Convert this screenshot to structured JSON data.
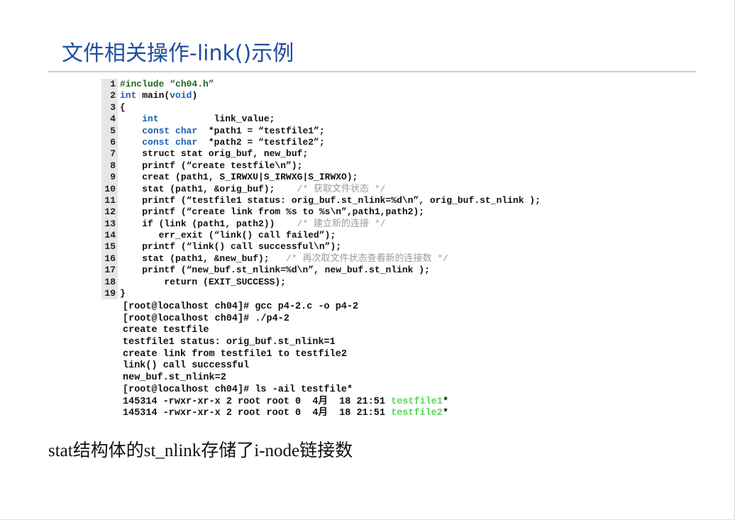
{
  "title": "文件相关操作-link()示例",
  "code_lines": [
    {
      "n": "1",
      "segs": [
        {
          "t": "#include ",
          "c": "str"
        },
        {
          "t": "“ch04.h”",
          "c": "str"
        }
      ]
    },
    {
      "n": "2",
      "segs": [
        {
          "t": "int",
          "c": "kw"
        },
        {
          "t": " main(",
          "c": ""
        },
        {
          "t": "void",
          "c": "kw"
        },
        {
          "t": ")",
          "c": ""
        }
      ]
    },
    {
      "n": "3",
      "segs": [
        {
          "t": "{",
          "c": ""
        }
      ]
    },
    {
      "n": "4",
      "segs": [
        {
          "t": "    ",
          "c": ""
        },
        {
          "t": "int",
          "c": "kw"
        },
        {
          "t": "          link_value;",
          "c": ""
        }
      ]
    },
    {
      "n": "5",
      "segs": [
        {
          "t": "    ",
          "c": ""
        },
        {
          "t": "const char",
          "c": "kw"
        },
        {
          "t": "  *path1 = “testfile1”;",
          "c": ""
        }
      ]
    },
    {
      "n": "6",
      "segs": [
        {
          "t": "    ",
          "c": ""
        },
        {
          "t": "const char",
          "c": "kw"
        },
        {
          "t": "  *path2 = “testfile2”;",
          "c": ""
        }
      ]
    },
    {
      "n": "7",
      "segs": [
        {
          "t": "    struct stat orig_buf, new_buf;",
          "c": ""
        }
      ]
    },
    {
      "n": "8",
      "segs": [
        {
          "t": "    printf (“create testfile\\n”);",
          "c": ""
        }
      ]
    },
    {
      "n": "9",
      "segs": [
        {
          "t": "    creat (path1, S_IRWXU|S_IRWXG|S_IRWXO);",
          "c": ""
        }
      ]
    },
    {
      "n": "10",
      "segs": [
        {
          "t": "    stat (path1, &orig_buf);    ",
          "c": ""
        },
        {
          "t": "/* 获取文件状态 */",
          "c": "cmt"
        }
      ]
    },
    {
      "n": "11",
      "segs": [
        {
          "t": "    printf (“testfile1 status: orig_buf.st_nlink=%d\\n”, orig_buf.st_nlink );",
          "c": ""
        }
      ]
    },
    {
      "n": "12",
      "segs": [
        {
          "t": "    printf (“create link from %s to %s\\n”,path1,path2);",
          "c": ""
        }
      ]
    },
    {
      "n": "13",
      "segs": [
        {
          "t": "    if (link (path1, path2))    ",
          "c": ""
        },
        {
          "t": "/* 建立新的连接 */",
          "c": "cmt"
        }
      ]
    },
    {
      "n": "14",
      "segs": [
        {
          "t": "       err_exit (“link() call failed”);",
          "c": ""
        }
      ]
    },
    {
      "n": "15",
      "segs": [
        {
          "t": "    printf (“link() call successful\\n”);",
          "c": ""
        }
      ]
    },
    {
      "n": "16",
      "segs": [
        {
          "t": "    stat (path1, &new_buf);   ",
          "c": ""
        },
        {
          "t": "/* 再次取文件状态查看新的连接数 */",
          "c": "cmt"
        }
      ]
    },
    {
      "n": "17",
      "segs": [
        {
          "t": "    printf (“new_buf.st_nlink=%d\\n”, new_buf.st_nlink );",
          "c": ""
        }
      ]
    },
    {
      "n": "18",
      "segs": [
        {
          "t": "        return (EXIT_SUCCESS);",
          "c": ""
        }
      ]
    },
    {
      "n": "19",
      "segs": [
        {
          "t": "}",
          "c": ""
        }
      ]
    }
  ],
  "terminal_lines": [
    {
      "segs": [
        {
          "t": "[root@localhost ch04]# gcc p4-2.c -o p4-2",
          "c": ""
        }
      ]
    },
    {
      "segs": [
        {
          "t": "[root@localhost ch04]# ./p4-2",
          "c": ""
        }
      ]
    },
    {
      "segs": [
        {
          "t": "create testfile",
          "c": ""
        }
      ]
    },
    {
      "segs": [
        {
          "t": "testfile1 status: orig_buf.st_nlink=1",
          "c": ""
        }
      ]
    },
    {
      "segs": [
        {
          "t": "create link from testfile1 to testfile2",
          "c": ""
        }
      ]
    },
    {
      "segs": [
        {
          "t": "link() call successful",
          "c": ""
        }
      ]
    },
    {
      "segs": [
        {
          "t": "new_buf.st_nlink=2",
          "c": ""
        }
      ]
    },
    {
      "segs": [
        {
          "t": "[root@localhost ch04]# ls -ail testfile*",
          "c": ""
        }
      ]
    },
    {
      "segs": [
        {
          "t": "145314 -rwxr-xr-x 2 root root 0  4月  18 21:51 ",
          "c": ""
        },
        {
          "t": "testfile1",
          "c": "grn"
        },
        {
          "t": "*",
          "c": ""
        }
      ]
    },
    {
      "segs": [
        {
          "t": "145314 -rwxr-xr-x 2 root root 0  4月  18 21:51 ",
          "c": ""
        },
        {
          "t": "testfile2",
          "c": "grn"
        },
        {
          "t": "*",
          "c": ""
        }
      ]
    }
  ],
  "caption": "stat结构体的st_nlink存储了i-node链接数",
  "colors": {
    "title": "#1f4e9e",
    "rule": "#c8c8f0",
    "keyword": "#1a5fb4",
    "string": "#1e6a1e",
    "comment": "#9a9a9a",
    "listing_filename": "#5cd65c"
  }
}
